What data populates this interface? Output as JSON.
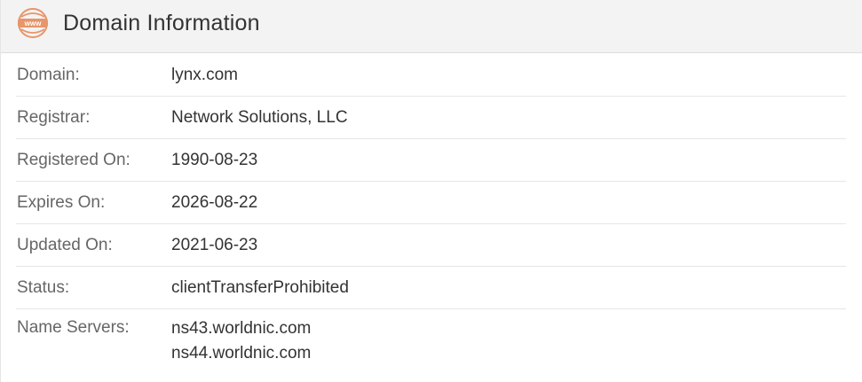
{
  "header": {
    "icon": "www-globe-icon",
    "icon_text": "www",
    "title": "Domain Information",
    "accent_color": "#e8956a"
  },
  "rows": [
    {
      "label": "Domain:",
      "value": "lynx.com"
    },
    {
      "label": "Registrar:",
      "value": "Network Solutions, LLC"
    },
    {
      "label": "Registered On:",
      "value": "1990-08-23"
    },
    {
      "label": "Expires On:",
      "value": "2026-08-22"
    },
    {
      "label": "Updated On:",
      "value": "2021-06-23"
    },
    {
      "label": "Status:",
      "value": "clientTransferProhibited"
    }
  ],
  "name_servers": {
    "label": "Name Servers:",
    "values": [
      "ns43.worldnic.com",
      "ns44.worldnic.com"
    ]
  }
}
